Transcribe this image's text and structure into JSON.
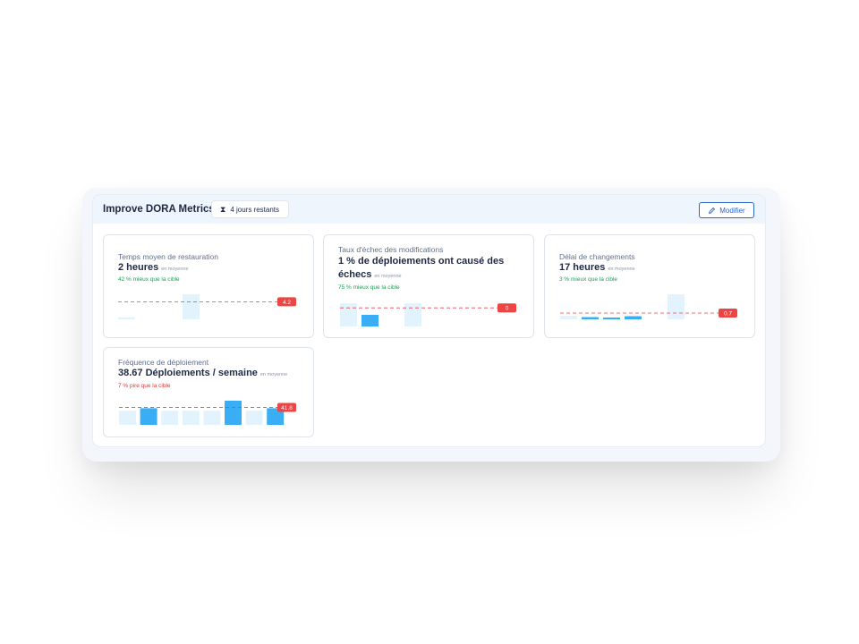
{
  "header": {
    "title": "Improve DORA Metrics",
    "badge_text": "4 jours restants",
    "edit_label": "Modifier"
  },
  "colors": {
    "good": "#1f9d55",
    "bad": "#d63a3a",
    "target_line": "#ef4444",
    "bar_primary": "#3aaef5",
    "bar_light": "#e3f3fd"
  },
  "cards": [
    {
      "title": "Temps moyen de restauration",
      "value": "2 heures",
      "unit_note": "en moyenne",
      "delta": "42 % mieux que la cible",
      "delta_status": "good",
      "target_label": "4.2",
      "bars": [
        {
          "value": 0.5,
          "highlight": false
        },
        {
          "value": 0,
          "highlight": false
        },
        {
          "value": 0,
          "highlight": false
        },
        {
          "value": 6.0,
          "highlight": false
        },
        {
          "value": 0,
          "highlight": false
        },
        {
          "value": 0,
          "highlight": false
        },
        {
          "value": 0,
          "highlight": false
        }
      ]
    },
    {
      "title": "Taux d'échec des modifications",
      "value": "1 % de déploiements ont causé des échecs",
      "unit_note": "en moyenne",
      "delta": "75 % mieux que la cible",
      "delta_status": "good",
      "target_label": "0",
      "bars": [
        {
          "value": 4.0,
          "highlight": false
        },
        {
          "value": 2.0,
          "highlight": true
        },
        {
          "value": 0,
          "highlight": false
        },
        {
          "value": 4.0,
          "highlight": false
        },
        {
          "value": 0,
          "highlight": false
        },
        {
          "value": 0,
          "highlight": false
        },
        {
          "value": 0,
          "highlight": false
        }
      ]
    },
    {
      "title": "Délai de changements",
      "value": "17 heures",
      "unit_note": "en moyenne",
      "delta": "3 % mieux que la cible",
      "delta_status": "good",
      "target_label": "0.7",
      "bars": [
        {
          "value": 0.4,
          "highlight": false
        },
        {
          "value": 0.25,
          "highlight": true
        },
        {
          "value": 0.2,
          "highlight": true
        },
        {
          "value": 0.35,
          "highlight": true
        },
        {
          "value": 0,
          "highlight": false
        },
        {
          "value": 2.8,
          "highlight": false
        },
        {
          "value": 0,
          "highlight": false
        }
      ]
    },
    {
      "title": "Fréquence de déploiement",
      "value": "38.67 Déploiements / semaine",
      "unit_note": "en moyenne",
      "delta": "7 % pire que la cible",
      "delta_status": "bad",
      "target_label": "41.8",
      "bars": [
        {
          "value": 34,
          "highlight": false
        },
        {
          "value": 40,
          "highlight": true
        },
        {
          "value": 34,
          "highlight": false
        },
        {
          "value": 34,
          "highlight": false
        },
        {
          "value": 34,
          "highlight": false
        },
        {
          "value": 58,
          "highlight": true
        },
        {
          "value": 34,
          "highlight": false
        },
        {
          "value": 40,
          "highlight": true
        }
      ]
    }
  ]
}
